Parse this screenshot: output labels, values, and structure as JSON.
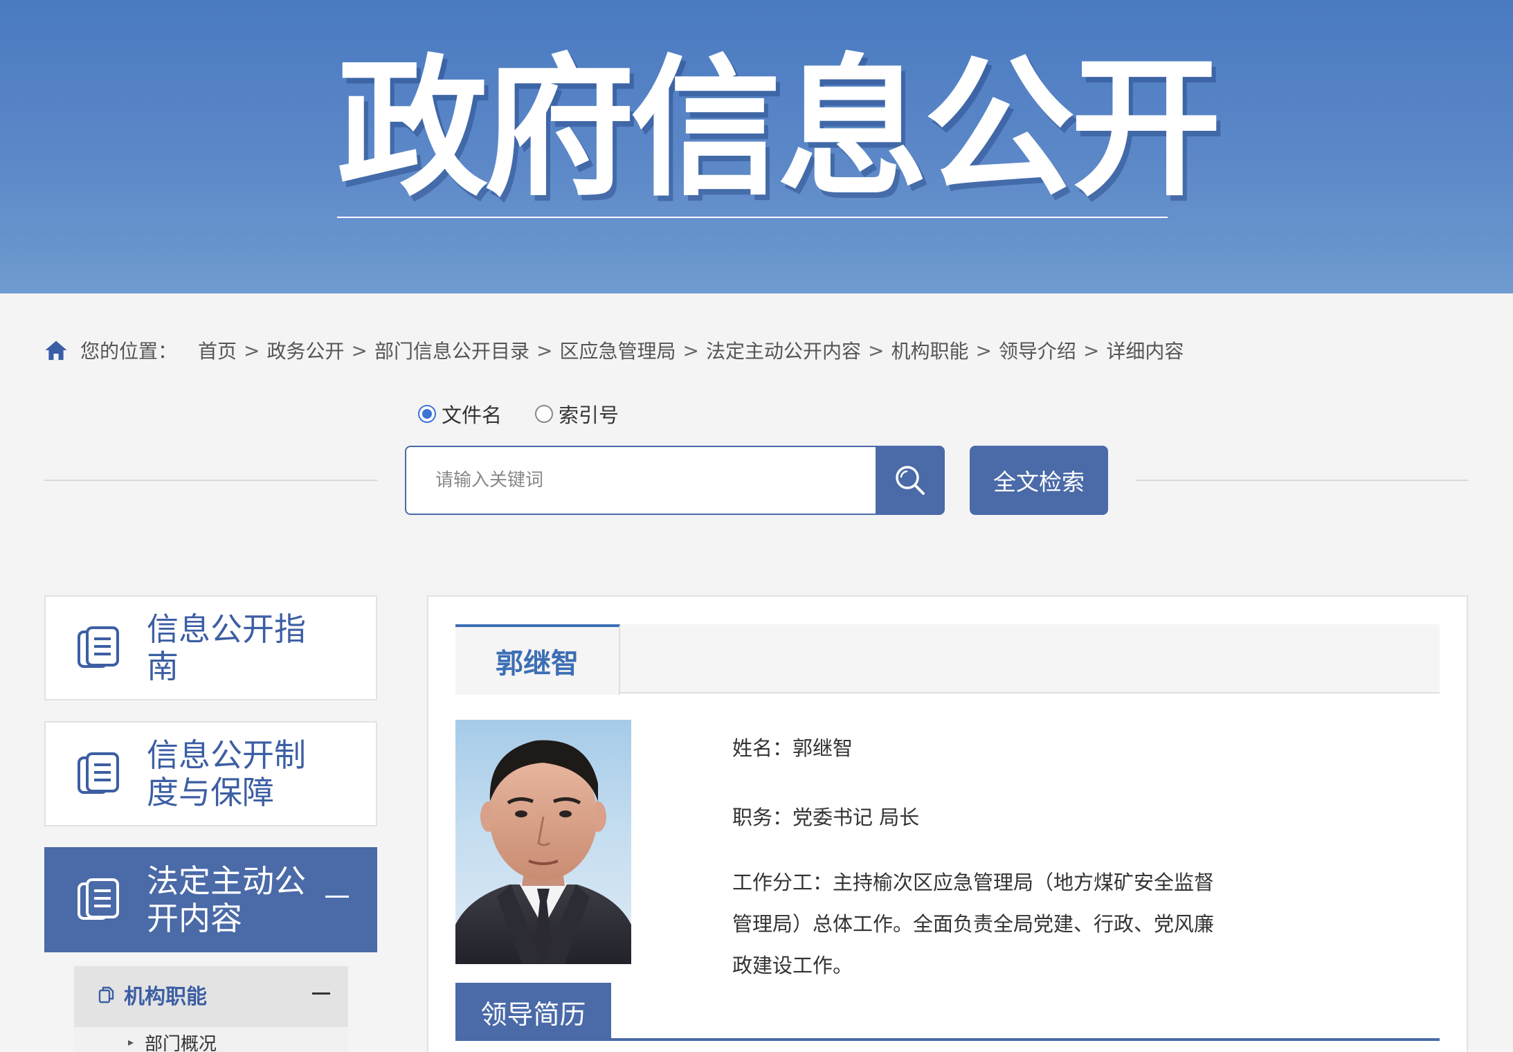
{
  "banner": {
    "title": "政府信息公开"
  },
  "breadcrumb": {
    "label": "您的位置：",
    "items": [
      "首页",
      "政务公开",
      "部门信息公开目录",
      "区应急管理局",
      "法定主动公开内容",
      "机构职能",
      "领导介绍",
      "详细内容"
    ],
    "separator": ">"
  },
  "search": {
    "radio_options": [
      {
        "label": "文件名",
        "checked": true
      },
      {
        "label": "索引号",
        "checked": false
      }
    ],
    "placeholder": "请输入关键词",
    "value": "",
    "fulltext_label": "全文检索"
  },
  "sidebar": {
    "items": [
      {
        "label": "信息公开指南",
        "active": false
      },
      {
        "label": "信息公开制度与保障",
        "active": false
      },
      {
        "label": "法定主动公开内容",
        "active": true
      }
    ],
    "sub_section": {
      "label": "机构职能",
      "items": [
        "部门概况"
      ]
    }
  },
  "content": {
    "tab_label": "郭继智",
    "name_line": "姓名：郭继智",
    "position_line": "职务：党委书记 局长",
    "duty_text": "工作分工：主持榆次区应急管理局（地方煤矿安全监督管理局）总体工作。全面负责全局党建、行政、党风廉政建设工作。",
    "bio_tab_label": "领导简历"
  },
  "colors": {
    "brand_blue": "#4a6aa8",
    "banner_blue": "#4a7ac0",
    "label_blue": "#3c5ea3",
    "radio_accent": "#3b73d6"
  },
  "icons": {
    "home": "home-icon",
    "search": "search-icon",
    "document": "document-stack-icon",
    "copy": "copy-icon"
  }
}
